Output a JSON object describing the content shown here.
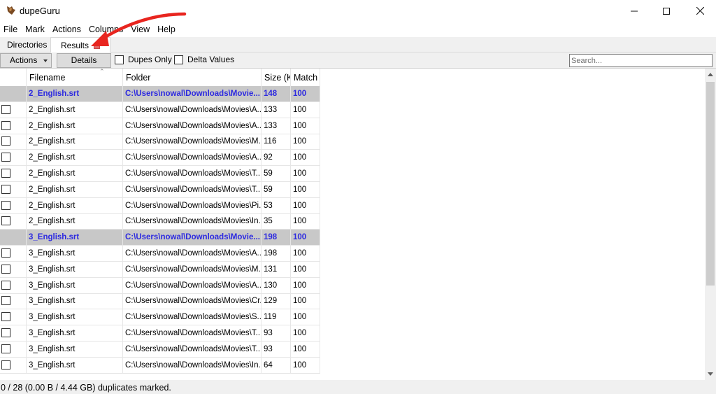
{
  "window": {
    "title": "dupeGuru"
  },
  "menu": [
    "File",
    "Mark",
    "Actions",
    "Columns",
    "View",
    "Help"
  ],
  "tabs": {
    "directories": "Directories",
    "results": "Results"
  },
  "toolbar": {
    "actions_label": "Actions",
    "details_label": "Details",
    "dupes_only_label": "Dupes Only",
    "delta_values_label": "Delta Values",
    "search_placeholder": "Search..."
  },
  "columns": [
    "Filename",
    "Folder",
    "Size (K",
    "Match"
  ],
  "rows": [
    {
      "group": true,
      "filename": "2_English.srt",
      "folder": "C:\\Users\\nowal\\Downloads\\Movie...",
      "size": "148",
      "match": "100"
    },
    {
      "group": false,
      "filename": "2_English.srt",
      "folder": "C:\\Users\\nowal\\Downloads\\Movies\\A...",
      "size": "133",
      "match": "100"
    },
    {
      "group": false,
      "filename": "2_English.srt",
      "folder": "C:\\Users\\nowal\\Downloads\\Movies\\A...",
      "size": "133",
      "match": "100"
    },
    {
      "group": false,
      "filename": "2_English.srt",
      "folder": "C:\\Users\\nowal\\Downloads\\Movies\\M...",
      "size": "116",
      "match": "100"
    },
    {
      "group": false,
      "filename": "2_English.srt",
      "folder": "C:\\Users\\nowal\\Downloads\\Movies\\A...",
      "size": "92",
      "match": "100"
    },
    {
      "group": false,
      "filename": "2_English.srt",
      "folder": "C:\\Users\\nowal\\Downloads\\Movies\\T...",
      "size": "59",
      "match": "100"
    },
    {
      "group": false,
      "filename": "2_English.srt",
      "folder": "C:\\Users\\nowal\\Downloads\\Movies\\T...",
      "size": "59",
      "match": "100"
    },
    {
      "group": false,
      "filename": "2_English.srt",
      "folder": "C:\\Users\\nowal\\Downloads\\Movies\\Pi...",
      "size": "53",
      "match": "100"
    },
    {
      "group": false,
      "filename": "2_English.srt",
      "folder": "C:\\Users\\nowal\\Downloads\\Movies\\In...",
      "size": "35",
      "match": "100"
    },
    {
      "group": true,
      "filename": "3_English.srt",
      "folder": "C:\\Users\\nowal\\Downloads\\Movie...",
      "size": "198",
      "match": "100"
    },
    {
      "group": false,
      "filename": "3_English.srt",
      "folder": "C:\\Users\\nowal\\Downloads\\Movies\\A...",
      "size": "198",
      "match": "100"
    },
    {
      "group": false,
      "filename": "3_English.srt",
      "folder": "C:\\Users\\nowal\\Downloads\\Movies\\M...",
      "size": "131",
      "match": "100"
    },
    {
      "group": false,
      "filename": "3_English.srt",
      "folder": "C:\\Users\\nowal\\Downloads\\Movies\\A...",
      "size": "130",
      "match": "100"
    },
    {
      "group": false,
      "filename": "3_English.srt",
      "folder": "C:\\Users\\nowal\\Downloads\\Movies\\Cr...",
      "size": "129",
      "match": "100"
    },
    {
      "group": false,
      "filename": "3_English.srt",
      "folder": "C:\\Users\\nowal\\Downloads\\Movies\\S...",
      "size": "119",
      "match": "100"
    },
    {
      "group": false,
      "filename": "3_English.srt",
      "folder": "C:\\Users\\nowal\\Downloads\\Movies\\T...",
      "size": "93",
      "match": "100"
    },
    {
      "group": false,
      "filename": "3_English.srt",
      "folder": "C:\\Users\\nowal\\Downloads\\Movies\\T...",
      "size": "93",
      "match": "100"
    },
    {
      "group": false,
      "filename": "3_English.srt",
      "folder": "C:\\Users\\nowal\\Downloads\\Movies\\In...",
      "size": "64",
      "match": "100"
    }
  ],
  "status": "0 / 28 (0.00 B / 4.44 GB) duplicates marked.",
  "colors": {
    "group_row_bg": "#c8c8c8",
    "group_row_text": "#2d2ae0",
    "annotation_arrow": "#e8251f"
  },
  "icons": {
    "app": "dupeguru-icon",
    "minimize": "minimize-icon",
    "maximize": "maximize-icon",
    "close": "close-icon",
    "annotation": "red-arrow-annotation"
  }
}
